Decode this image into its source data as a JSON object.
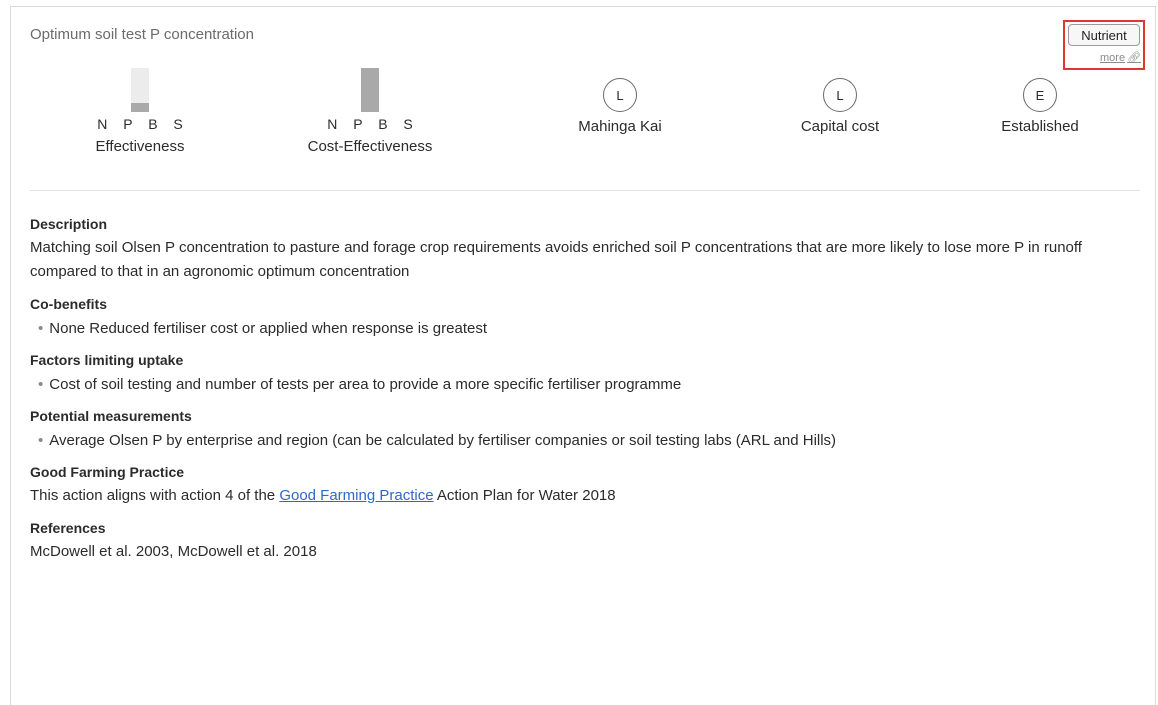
{
  "header": {
    "title": "Optimum soil test P concentration",
    "tag_label": "Nutrient",
    "more_label": "more",
    "accent_highlight": "#e0362b"
  },
  "metrics": [
    {
      "letters": "N P B S",
      "caption": "Effectiveness",
      "bar_level": 0.2
    },
    {
      "letters": "N P B S",
      "caption": "Cost-Effectiveness",
      "bar_level": 1.0
    },
    {
      "badge": "L",
      "caption": "Mahinga Kai"
    },
    {
      "badge": "L",
      "caption": "Capital cost"
    },
    {
      "badge": "E",
      "caption": "Established"
    }
  ],
  "sections": {
    "description": {
      "heading": "Description",
      "text": "Matching soil Olsen P concentration to pasture and forage crop requirements avoids enriched soil P concentrations that are more likely to lose more P in runoff compared to that in an agronomic optimum concentration"
    },
    "cobenefits": {
      "heading": "Co-benefits",
      "items": [
        "None Reduced fertiliser cost or applied when response is greatest"
      ]
    },
    "factors": {
      "heading": "Factors limiting uptake",
      "items": [
        "Cost of soil testing and number of tests per area to provide a more specific fertiliser programme"
      ]
    },
    "measurements": {
      "heading": "Potential measurements",
      "items": [
        "Average Olsen P by enterprise and region (can be calculated by fertiliser companies or soil testing labs (ARL and Hills)"
      ]
    },
    "gfp": {
      "heading": "Good Farming Practice",
      "before": "This action aligns with action 4 of the ",
      "link": "Good Farming Practice",
      "after": " Action Plan for Water 2018"
    },
    "references": {
      "heading": "References",
      "text": "McDowell et al. 2003, McDowell et al. 2018"
    }
  }
}
